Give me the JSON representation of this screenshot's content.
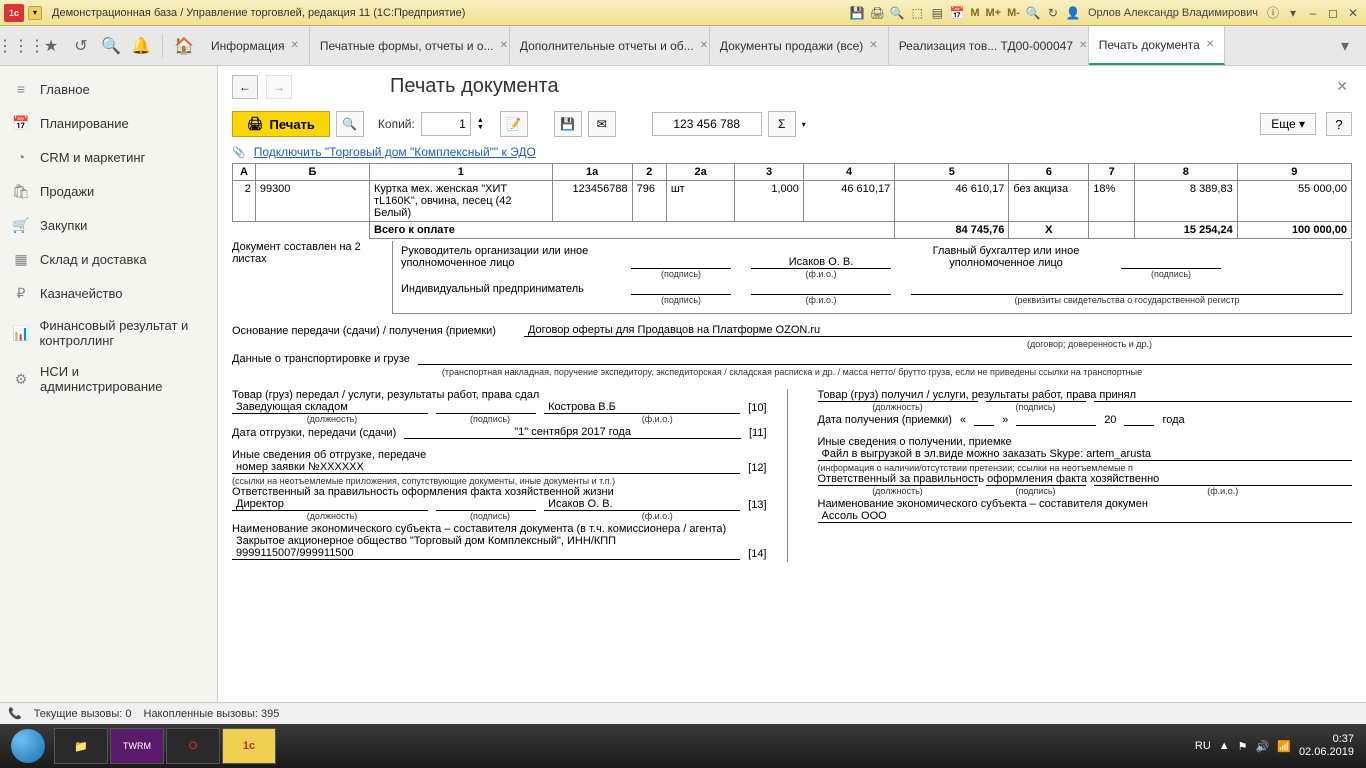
{
  "titlebar": {
    "title": "Демонстрационная база / Управление торговлей, редакция 11 (1С:Предприятие)",
    "user": "Орлов Александр Владимирович",
    "m_items": [
      "M",
      "M+",
      "M-"
    ]
  },
  "tabs": [
    {
      "label": "Информация"
    },
    {
      "label": "Печатные формы, отчеты и о..."
    },
    {
      "label": "Дополнительные отчеты и об..."
    },
    {
      "label": "Документы продажи (все)"
    },
    {
      "label": "Реализация тов... ТД00-000047"
    },
    {
      "label": "Печать документа",
      "active": true
    }
  ],
  "sidebar": [
    {
      "icon": "≡",
      "label": "Главное"
    },
    {
      "icon": "📅",
      "label": "Планирование"
    },
    {
      "icon": "◔",
      "label": "CRM и маркетинг"
    },
    {
      "icon": "🛍",
      "label": "Продажи"
    },
    {
      "icon": "🛒",
      "label": "Закупки"
    },
    {
      "icon": "▦",
      "label": "Склад и доставка"
    },
    {
      "icon": "₽",
      "label": "Казначейство"
    },
    {
      "icon": "📊",
      "label": "Финансовый результат и контроллинг"
    },
    {
      "icon": "⚙",
      "label": "НСИ и администрирование"
    }
  ],
  "page": {
    "title": "Печать документа",
    "print_label": "Печать",
    "copies_label": "Копий:",
    "copies_value": "1",
    "num_value": "123 456 788",
    "sum_icon": "Σ",
    "more_label": "Еще",
    "edo_link": "Подключить \"Торговый дом \"Комплексный\"\" к ЭДО"
  },
  "table": {
    "headers": [
      "А",
      "Б",
      "1",
      "1а",
      "2",
      "2а",
      "3",
      "4",
      "5",
      "6",
      "7",
      "8",
      "9"
    ],
    "row": {
      "c0": "2",
      "c1": "99300",
      "c2": "Куртка мех. женская \"ХИТ тL160K\", овчина, песец (42 Белый)",
      "c3": "123456788",
      "c4": "796",
      "c5": "шт",
      "c6": "1,000",
      "c7": "46 610,17",
      "c8": "46 610,17",
      "c9": "без акциза",
      "c10": "18%",
      "c11": "8 389,83",
      "c12": "55 000,00"
    },
    "total_label": "Всего к оплате",
    "total_5": "84 745,76",
    "total_6": "X",
    "total_8": "15 254,24",
    "total_9": "100 000,00"
  },
  "sig": {
    "doc_pages": "Документ составлен на 2 листах",
    "head_label": "Руководитель организации или иное уполномоченное лицо",
    "head_name": "Исаков О. В.",
    "accountant_label": "Главный бухгалтер или иное уполномоченное лицо",
    "ip_label": "Индивидуальный предприниматель",
    "sign_hint": "(подпись)",
    "fio_hint": "(ф.и.о.)",
    "reg_hint": "(реквизиты свидетельства о государственной регистр"
  },
  "form": {
    "basis_label": "Основание передачи (сдачи) / получения (приемки)",
    "basis_value": "Договор оферты для Продавцов на Платформе OZON.ru",
    "basis_hint": "(договор; доверенность и др.)",
    "transport_label": "Данные о транспортировке и грузе",
    "transport_hint": "(транспортная накладная, поручение экспедитору, экспедиторская / складская расписка и др. / масса нетто/ брутто груза, если не приведены ссылки на транспортные"
  },
  "left_col": {
    "l1": "Товар (груз) передал / услуги, результаты работ, права сдал",
    "l2_pos": "Заведующая складом",
    "l2_name": "Кострова В.Б",
    "l2_num": "[10]",
    "pos_hint": "(должность)",
    "sign_hint": "(подпись)",
    "fio_hint": "(ф.и.о.)",
    "l3_label": "Дата отгрузки, передачи (сдачи)",
    "l3_date": "\"1\" сентября 2017 года",
    "l3_num": "[11]",
    "l4_label": "Иные сведения об отгрузке, передаче",
    "l5_value": "номер заявки №XXXXXX",
    "l5_num": "[12]",
    "l5_hint": "(ссылки на неотъемлемые приложения, сопутствующие документы, иные документы и т.п.)",
    "l6_label": "Ответственный за правильность оформления факта хозяйственной жизни",
    "l7_pos": "Директор",
    "l7_name": "Исаков О. В.",
    "l7_num": "[13]",
    "l8_label": "Наименование экономического субъекта – составителя документа (в т.ч. комиссионера / агента)",
    "l9_value": "Закрытое акционерное общество \"Торговый дом Комплексный\", ИНН/КПП 9999115007/999911500",
    "l9_num": "[14]"
  },
  "right_col": {
    "r1": "Товар (груз) получил / услуги, результаты работ, права принял",
    "r2_label": "Дата получения (приемки)",
    "r2_date_q1": "«",
    "r2_date_q2": "»",
    "r2_date_y": "20",
    "r2_date_suffix": "года",
    "r3_label": "Иные сведения о получении, приемке",
    "r4_value": "Файл в выгрузкой в эл.виде можно заказать Skype: artem_arusta",
    "r4_hint": "(информация о наличии/отсутствии претензии; ссылки на неотъемлемые п",
    "r5_label": "Ответственный за правильность оформления факта хозяйственно",
    "r6_label": "Наименование экономического субъекта – составителя докумен",
    "r7_value": "Ассоль ООО"
  },
  "statusbar": {
    "calls": "Текущие вызовы: 0",
    "accumulated": "Накопленные вызовы: 395"
  },
  "taskbar": {
    "lang": "RU",
    "time": "0:37",
    "date": "02.06.2019"
  }
}
